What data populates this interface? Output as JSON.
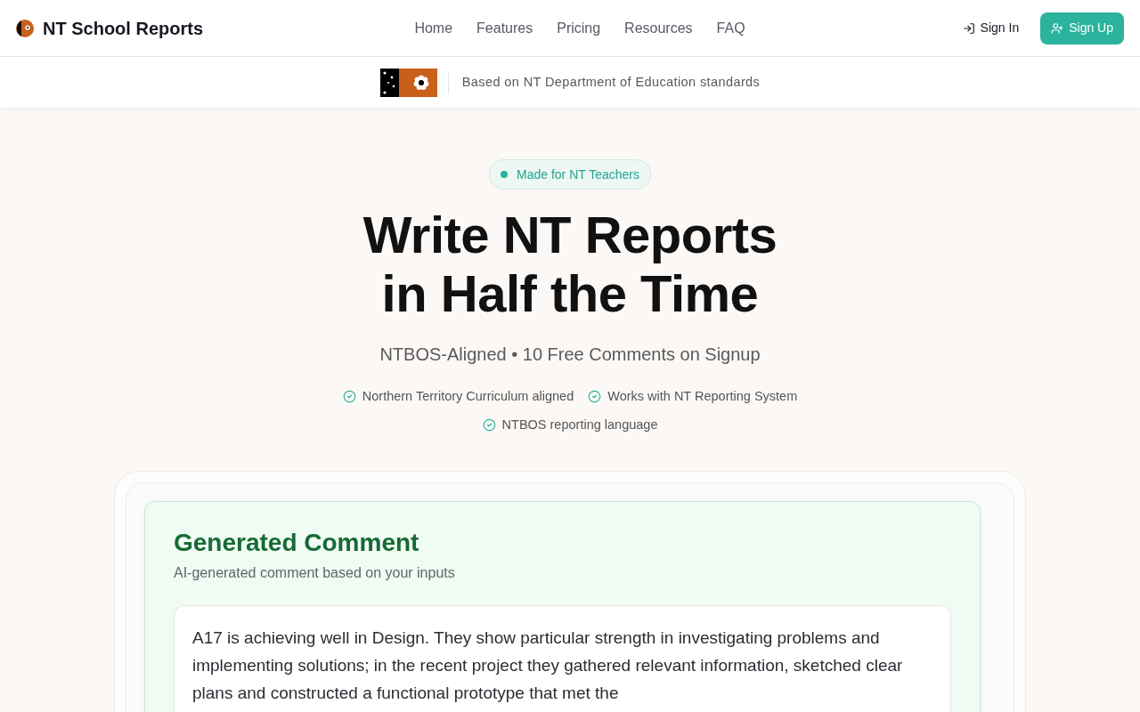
{
  "header": {
    "logo_text": "NT School Reports",
    "nav": [
      "Home",
      "Features",
      "Pricing",
      "Resources",
      "FAQ"
    ],
    "sign_in": "Sign In",
    "sign_up": "Sign Up"
  },
  "banner": {
    "text": "Based on NT Department of Education standards"
  },
  "hero": {
    "badge": "Made for NT Teachers",
    "title_lines": [
      "Write NT Reports",
      "in Half the Time"
    ],
    "subtitle": "NTBOS-Aligned • 10 Free Comments on Signup",
    "features": [
      "Northern Territory Curriculum aligned",
      "Works with NT Reporting System",
      "NTBOS reporting language"
    ]
  },
  "preview": {
    "title": "Generated Comment",
    "subtitle": "AI-generated comment based on your inputs",
    "comment": "A17 is achieving well in Design. They show particular strength in investigating problems and implementing solutions; in the recent project they gathered relevant information, sketched clear plans and constructed a functional prototype that met the"
  }
}
